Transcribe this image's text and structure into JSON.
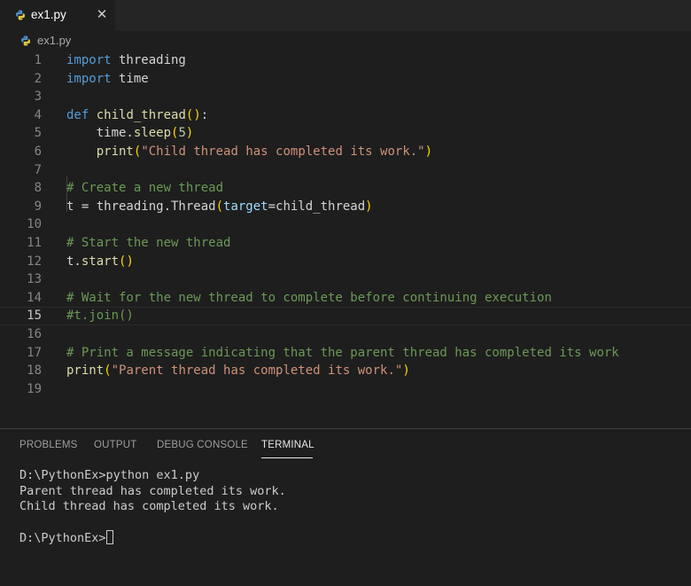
{
  "tab": {
    "label": "ex1.py",
    "close": "✕"
  },
  "breadcrumb": {
    "file": "ex1.py"
  },
  "editor": {
    "current_line": 15,
    "lines": [
      [
        {
          "t": "kw",
          "v": "import"
        },
        {
          "t": "",
          "v": " threading"
        }
      ],
      [
        {
          "t": "kw",
          "v": "import"
        },
        {
          "t": "",
          "v": " time"
        }
      ],
      [],
      [
        {
          "t": "kw",
          "v": "def"
        },
        {
          "t": "",
          "v": " "
        },
        {
          "t": "fn",
          "v": "child_thread"
        },
        {
          "t": "par",
          "v": "()"
        },
        {
          "t": "",
          "v": ":"
        }
      ],
      [
        {
          "t": "",
          "v": "    time."
        },
        {
          "t": "fn",
          "v": "sleep"
        },
        {
          "t": "par",
          "v": "("
        },
        {
          "t": "num",
          "v": "5"
        },
        {
          "t": "par",
          "v": ")"
        }
      ],
      [
        {
          "t": "",
          "v": "    "
        },
        {
          "t": "fn",
          "v": "print"
        },
        {
          "t": "par",
          "v": "("
        },
        {
          "t": "str",
          "v": "\"Child thread has completed its work.\""
        },
        {
          "t": "par",
          "v": ")"
        }
      ],
      [],
      [
        {
          "t": "cmt",
          "v": "# Create a new thread"
        }
      ],
      [
        {
          "t": "",
          "v": "t = threading.Thread"
        },
        {
          "t": "par",
          "v": "("
        },
        {
          "t": "prm",
          "v": "target"
        },
        {
          "t": "",
          "v": "=child_thread"
        },
        {
          "t": "par",
          "v": ")"
        }
      ],
      [],
      [
        {
          "t": "cmt",
          "v": "# Start the new thread"
        }
      ],
      [
        {
          "t": "",
          "v": "t."
        },
        {
          "t": "fn",
          "v": "start"
        },
        {
          "t": "par",
          "v": "()"
        }
      ],
      [],
      [
        {
          "t": "cmt",
          "v": "# Wait for the new thread to complete before continuing execution"
        }
      ],
      [
        {
          "t": "cmt",
          "v": "#t.join()"
        }
      ],
      [],
      [
        {
          "t": "cmt",
          "v": "# Print a message indicating that the parent thread has completed its work"
        }
      ],
      [
        {
          "t": "fn",
          "v": "print"
        },
        {
          "t": "par",
          "v": "("
        },
        {
          "t": "str",
          "v": "\"Parent thread has completed its work.\""
        },
        {
          "t": "par",
          "v": ")"
        }
      ],
      []
    ]
  },
  "panel": {
    "tabs": [
      "PROBLEMS",
      "OUTPUT",
      "DEBUG CONSOLE",
      "TERMINAL"
    ],
    "active_tab": "TERMINAL",
    "terminal_lines": [
      "D:\\PythonEx>python ex1.py",
      "Parent thread has completed its work.",
      "Child thread has completed its work.",
      "",
      "D:\\PythonEx>"
    ]
  },
  "colors": {
    "keyword": "#569cd6",
    "function": "#dcdcaa",
    "string": "#ce9178",
    "number": "#b5cea8",
    "comment": "#6a9955",
    "bracket": "#ffd700",
    "param": "#9cdcfe"
  },
  "icons": {
    "file": "python-icon",
    "close": "close-icon"
  }
}
